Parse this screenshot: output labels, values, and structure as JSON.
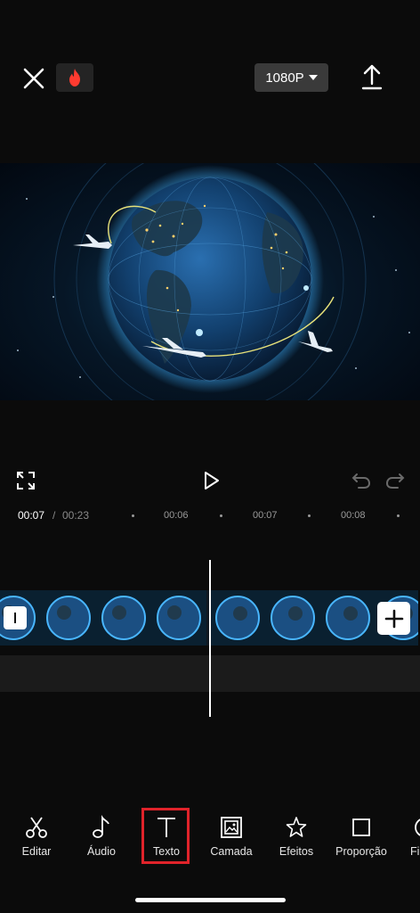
{
  "header": {
    "close_icon": "close-icon",
    "fire_icon": "fire-icon",
    "resolution": "1080P",
    "export_icon": "upload-icon"
  },
  "preview": {
    "content": "earth-globe-with-airplanes"
  },
  "controls": {
    "fullscreen_icon": "fullscreen-icon",
    "play_icon": "play-icon",
    "undo_icon": "undo-icon",
    "redo_icon": "redo-icon"
  },
  "ruler": {
    "current_time": "00:07",
    "separator": "/",
    "total_time": "00:23",
    "ticks": [
      "00:06",
      "00:07",
      "00:08"
    ]
  },
  "timeline": {
    "add_clip_icon": "plus-icon"
  },
  "toolbar": {
    "items": [
      {
        "label": "Editar",
        "icon": "scissors-icon"
      },
      {
        "label": "Áudio",
        "icon": "music-note-icon"
      },
      {
        "label": "Texto",
        "icon": "text-icon"
      },
      {
        "label": "Camada",
        "icon": "overlay-icon"
      },
      {
        "label": "Efeitos",
        "icon": "star-icon"
      },
      {
        "label": "Proporção",
        "icon": "square-icon"
      },
      {
        "label": "Fi",
        "icon": "filter-icon"
      }
    ]
  },
  "colors": {
    "background": "#0b0b0b",
    "highlight": "#e0232a",
    "fire": "#ff3b30"
  }
}
